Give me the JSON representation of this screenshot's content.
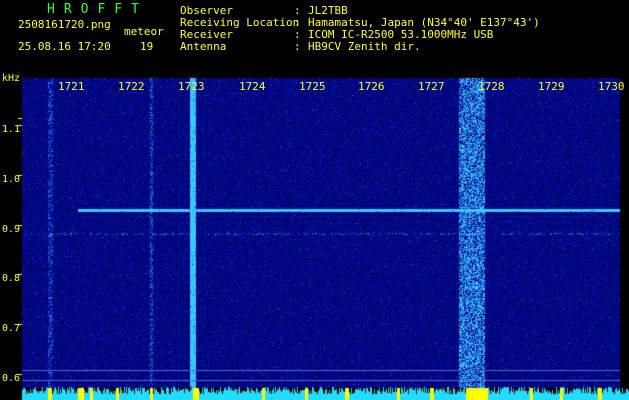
{
  "app": {
    "title": "HROFFT"
  },
  "capture": {
    "filename": "2508161720.png",
    "datetime": "25.08.16 17:20",
    "count_label": "meteor",
    "count_value": "19"
  },
  "station": {
    "rows": [
      {
        "key": "Observer",
        "value": "JL2TBB"
      },
      {
        "key": "Receiving Location",
        "value": "Hamamatsu, Japan (N34°40' E137°43')"
      },
      {
        "key": "Receiver",
        "value": "ICOM IC-R2500 53.1000MHz USB"
      },
      {
        "key": "Antenna",
        "value": "HB9CV Zenith dir."
      }
    ],
    "separator": ":"
  },
  "plot": {
    "y_unit": "kHz",
    "x_ticks": [
      "1721",
      "1722",
      "1723",
      "1724",
      "1725",
      "1726",
      "1727",
      "1728",
      "1729",
      "1730"
    ],
    "y_ticks": [
      "1.1",
      "1.0",
      "0.9",
      "0.8",
      "0.7",
      "0.6"
    ],
    "colors": {
      "background": "#000000",
      "noise_base": "#0a0a6e",
      "signal": "#33ccff",
      "labels": "#ffff33",
      "title": "#33ff33",
      "bottom_trace": "#22ddff",
      "bottom_marks": "#ffff00"
    }
  }
}
